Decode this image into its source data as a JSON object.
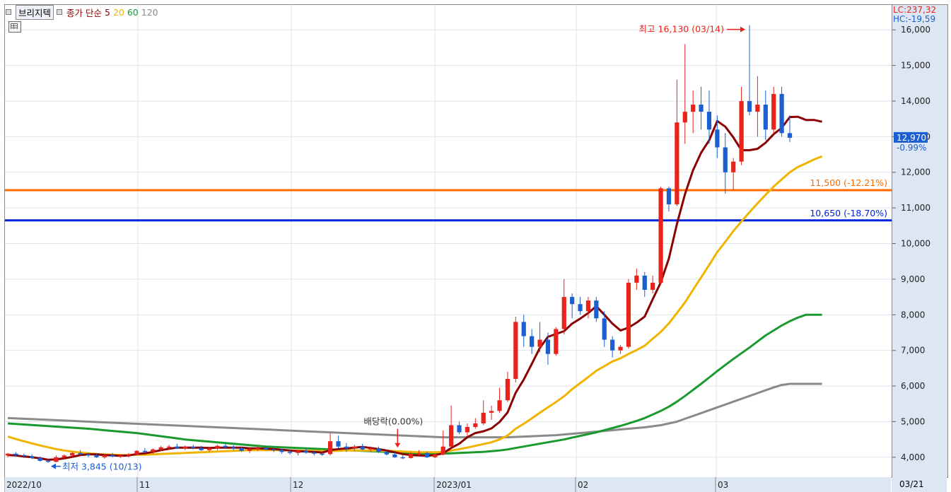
{
  "legend": {
    "stock_name": "브리지텍",
    "ma_prefix": "종가 단순",
    "ma_periods": [
      "5",
      "20",
      "60",
      "120"
    ],
    "ma_colors": [
      "#8b0000",
      "#f0b400",
      "#1a9a2e",
      "#8a8a8a"
    ]
  },
  "lc_label": "LC:237,32",
  "hc_label": "HC:-19,59",
  "colors": {
    "up": "#e8231b",
    "down": "#1c5fd0",
    "orange_line": "#ff6a00",
    "blue_line": "#0022dd"
  },
  "chart_data": {
    "type": "candlestick",
    "x_ticks": [
      "2022/10",
      "11",
      "12",
      "2023/01",
      "02",
      "03",
      "03/21"
    ],
    "y_ticks": [
      "16,000",
      "15,000",
      "14,000",
      "13,000",
      "12,000",
      "11,000",
      "10,000",
      "9,000",
      "8,000",
      "7,000",
      "6,000",
      "5,000",
      "4,000"
    ],
    "ylim": [
      3600,
      16500
    ],
    "grid": true,
    "current_price_label": "12,970",
    "current_change_label": "-0.99%",
    "max_annotation": "최고 16,130 (03/14)",
    "min_annotation": "최저 3,845 (10/13)",
    "dividend_annotation": "배당락(0.00%)",
    "hlines": [
      {
        "value": 11500,
        "label": "11,500 (-12.21%)",
        "color": "#ff6a00"
      },
      {
        "value": 10650,
        "label": "10,650 (-18.70%)",
        "color": "#0022dd"
      }
    ],
    "candles": [
      [
        4050,
        4120,
        4000,
        4100
      ],
      [
        4100,
        4150,
        4020,
        4060
      ],
      [
        4060,
        4100,
        3980,
        4030
      ],
      [
        4030,
        4080,
        3950,
        3980
      ],
      [
        3980,
        4020,
        3880,
        3900
      ],
      [
        3900,
        3950,
        3845,
        3870
      ],
      [
        3870,
        4050,
        3860,
        4000
      ],
      [
        4000,
        4080,
        3950,
        4050
      ],
      [
        4050,
        4150,
        4000,
        4120
      ],
      [
        4120,
        4200,
        4050,
        4080
      ],
      [
        4080,
        4130,
        4000,
        4050
      ],
      [
        4050,
        4100,
        3980,
        4000
      ],
      [
        4000,
        4080,
        3960,
        4060
      ],
      [
        4060,
        4120,
        4000,
        4020
      ],
      [
        4020,
        4080,
        3980,
        4050
      ],
      [
        4050,
        4120,
        4000,
        4080
      ],
      [
        4080,
        4200,
        4050,
        4180
      ],
      [
        4180,
        4260,
        4120,
        4150
      ],
      [
        4150,
        4250,
        4100,
        4220
      ],
      [
        4220,
        4320,
        4180,
        4280
      ],
      [
        4280,
        4350,
        4200,
        4300
      ],
      [
        4300,
        4380,
        4230,
        4250
      ],
      [
        4250,
        4330,
        4200,
        4300
      ],
      [
        4300,
        4350,
        4220,
        4260
      ],
      [
        4260,
        4320,
        4180,
        4200
      ],
      [
        4200,
        4280,
        4150,
        4250
      ],
      [
        4250,
        4350,
        4200,
        4320
      ],
      [
        4320,
        4380,
        4250,
        4280
      ],
      [
        4280,
        4340,
        4200,
        4260
      ],
      [
        4260,
        4300,
        4150,
        4180
      ],
      [
        4180,
        4260,
        4120,
        4230
      ],
      [
        4230,
        4300,
        4180,
        4260
      ],
      [
        4260,
        4320,
        4200,
        4220
      ],
      [
        4220,
        4280,
        4150,
        4200
      ],
      [
        4200,
        4240,
        4100,
        4150
      ],
      [
        4150,
        4220,
        4080,
        4120
      ],
      [
        4120,
        4200,
        4050,
        4180
      ],
      [
        4180,
        4240,
        4100,
        4130
      ],
      [
        4130,
        4180,
        4050,
        4100
      ],
      [
        4100,
        4160,
        4040,
        4090
      ],
      [
        4090,
        4680,
        4050,
        4450
      ],
      [
        4450,
        4600,
        4250,
        4300
      ],
      [
        4300,
        4400,
        4150,
        4250
      ],
      [
        4250,
        4350,
        4180,
        4300
      ],
      [
        4300,
        4380,
        4200,
        4220
      ],
      [
        4220,
        4300,
        4150,
        4250
      ],
      [
        4250,
        4300,
        4120,
        4150
      ],
      [
        4150,
        4200,
        4050,
        4080
      ],
      [
        4080,
        4150,
        3980,
        4000
      ],
      [
        4000,
        4080,
        3950,
        3980
      ],
      [
        3980,
        4150,
        3960,
        4100
      ],
      [
        4100,
        4200,
        4050,
        4120
      ],
      [
        4120,
        4150,
        3980,
        4000
      ],
      [
        4000,
        4100,
        3980,
        4080
      ],
      [
        4080,
        4750,
        4050,
        4300
      ],
      [
        4300,
        5450,
        4280,
        4900
      ],
      [
        4900,
        5000,
        4650,
        4700
      ],
      [
        4700,
        4950,
        4600,
        4850
      ],
      [
        4850,
        5100,
        4800,
        4950
      ],
      [
        4950,
        5600,
        4900,
        5250
      ],
      [
        5250,
        5450,
        5050,
        5300
      ],
      [
        5300,
        5950,
        5250,
        5600
      ],
      [
        5600,
        6400,
        5550,
        6200
      ],
      [
        6200,
        7950,
        6100,
        7800
      ],
      [
        7800,
        8000,
        7100,
        7400
      ],
      [
        7400,
        7600,
        6900,
        7100
      ],
      [
        7100,
        7800,
        6950,
        7300
      ],
      [
        7300,
        7500,
        6600,
        6900
      ],
      [
        6900,
        7650,
        6850,
        7600
      ],
      [
        7600,
        9000,
        7450,
        8500
      ],
      [
        8500,
        8600,
        7900,
        8300
      ],
      [
        8300,
        8500,
        8000,
        8100
      ],
      [
        8100,
        8500,
        7900,
        8400
      ],
      [
        8400,
        8500,
        7800,
        7900
      ],
      [
        7900,
        8100,
        7100,
        7300
      ],
      [
        7300,
        7400,
        6800,
        7000
      ],
      [
        7000,
        7150,
        6900,
        7100
      ],
      [
        7100,
        9000,
        7050,
        8900
      ],
      [
        8900,
        9300,
        8700,
        9100
      ],
      [
        9100,
        9200,
        8500,
        8700
      ],
      [
        8700,
        9100,
        8600,
        8900
      ],
      [
        8900,
        11600,
        8850,
        11550
      ],
      [
        11550,
        11600,
        10900,
        11100
      ],
      [
        11100,
        14600,
        11050,
        13400
      ],
      [
        13400,
        15600,
        12800,
        13700
      ],
      [
        13700,
        14300,
        13100,
        13900
      ],
      [
        13900,
        14400,
        13200,
        13700
      ],
      [
        13700,
        14300,
        12800,
        13200
      ],
      [
        13200,
        13600,
        12400,
        12700
      ],
      [
        12700,
        13100,
        11400,
        12000
      ],
      [
        12000,
        12400,
        11500,
        12300
      ],
      [
        12300,
        14400,
        12200,
        14000
      ],
      [
        14000,
        16130,
        13600,
        13700
      ],
      [
        13700,
        14700,
        13000,
        13900
      ],
      [
        13900,
        14300,
        12900,
        13200
      ],
      [
        13200,
        14400,
        13100,
        14200
      ],
      [
        14200,
        14400,
        13000,
        13100
      ],
      [
        13100,
        13600,
        12850,
        12970
      ]
    ],
    "ma5": [
      4060,
      4050,
      4020,
      4000,
      3970,
      3930,
      3940,
      3970,
      4010,
      4060,
      4080,
      4080,
      4060,
      4050,
      4040,
      4050,
      4090,
      4110,
      4150,
      4200,
      4240,
      4270,
      4270,
      4270,
      4270,
      4260,
      4270,
      4270,
      4270,
      4270,
      4250,
      4250,
      4240,
      4230,
      4210,
      4190,
      4170,
      4160,
      4150,
      4130,
      4200,
      4230,
      4250,
      4270,
      4290,
      4260,
      4230,
      4190,
      4140,
      4090,
      4060,
      4050,
      4040,
      4060,
      4110,
      4260,
      4380,
      4560,
      4680,
      4730,
      4810,
      4990,
      5260,
      5810,
      6180,
      6620,
      7070,
      7380,
      7460,
      7540,
      7750,
      7890,
      8050,
      8240,
      8000,
      7750,
      7560,
      7640,
      7780,
      7950,
      8440,
      8910,
      9580,
      10550,
      11390,
      12060,
      12550,
      12900,
      13440,
      13280,
      12980,
      12620,
      12620,
      12660,
      12830,
      13070,
      13250,
      13550,
      13560,
      13470,
      13470,
      13420
    ],
    "ma20": [
      4580,
      4510,
      4450,
      4390,
      4330,
      4280,
      4230,
      4190,
      4160,
      4130,
      4110,
      4090,
      4080,
      4070,
      4060,
      4060,
      4070,
      4070,
      4080,
      4090,
      4100,
      4110,
      4120,
      4130,
      4140,
      4150,
      4160,
      4170,
      4180,
      4190,
      4200,
      4200,
      4200,
      4200,
      4200,
      4190,
      4190,
      4180,
      4180,
      4170,
      4180,
      4180,
      4190,
      4190,
      4190,
      4190,
      4180,
      4180,
      4170,
      4160,
      4150,
      4140,
      4140,
      4140,
      4150,
      4190,
      4230,
      4270,
      4320,
      4370,
      4420,
      4500,
      4610,
      4800,
      4940,
      5090,
      5250,
      5400,
      5550,
      5710,
      5910,
      6080,
      6250,
      6430,
      6560,
      6690,
      6780,
      6900,
      7010,
      7130,
      7330,
      7520,
      7760,
      8050,
      8350,
      8700,
      9050,
      9400,
      9760,
      10050,
      10350,
      10620,
      10880,
      11130,
      11370,
      11600,
      11800,
      12000,
      12150,
      12250,
      12360,
      12450
    ],
    "ma60": [
      4950,
      4935,
      4920,
      4905,
      4890,
      4875,
      4860,
      4845,
      4830,
      4815,
      4800,
      4780,
      4760,
      4740,
      4720,
      4700,
      4680,
      4650,
      4620,
      4590,
      4560,
      4530,
      4500,
      4480,
      4460,
      4440,
      4420,
      4400,
      4380,
      4360,
      4340,
      4320,
      4300,
      4290,
      4280,
      4270,
      4260,
      4250,
      4240,
      4230,
      4220,
      4210,
      4200,
      4190,
      4180,
      4170,
      4160,
      4150,
      4140,
      4130,
      4120,
      4110,
      4100,
      4100,
      4100,
      4110,
      4120,
      4130,
      4140,
      4150,
      4170,
      4190,
      4220,
      4260,
      4300,
      4340,
      4380,
      4420,
      4460,
      4500,
      4550,
      4600,
      4650,
      4700,
      4760,
      4820,
      4880,
      4950,
      5020,
      5100,
      5200,
      5300,
      5420,
      5560,
      5720,
      5890,
      6060,
      6240,
      6420,
      6590,
      6760,
      6920,
      7080,
      7250,
      7420,
      7560,
      7700,
      7820,
      7920,
      8000,
      8000,
      8000
    ],
    "ma120": [
      5100,
      5090,
      5080,
      5070,
      5060,
      5050,
      5040,
      5030,
      5020,
      5010,
      5000,
      4990,
      4980,
      4970,
      4960,
      4950,
      4940,
      4930,
      4920,
      4910,
      4900,
      4890,
      4880,
      4870,
      4860,
      4850,
      4840,
      4830,
      4820,
      4810,
      4800,
      4790,
      4780,
      4770,
      4760,
      4750,
      4740,
      4730,
      4720,
      4710,
      4700,
      4690,
      4680,
      4670,
      4660,
      4650,
      4640,
      4630,
      4620,
      4610,
      4600,
      4590,
      4580,
      4570,
      4560,
      4560,
      4560,
      4560,
      4560,
      4560,
      4560,
      4560,
      4560,
      4570,
      4580,
      4590,
      4600,
      4610,
      4620,
      4640,
      4660,
      4680,
      4700,
      4720,
      4740,
      4760,
      4780,
      4800,
      4820,
      4840,
      4870,
      4900,
      4950,
      5000,
      5080,
      5160,
      5240,
      5320,
      5400,
      5480,
      5560,
      5640,
      5720,
      5800,
      5880,
      5960,
      6030,
      6060,
      6060,
      6060,
      6060,
      6060
    ]
  }
}
